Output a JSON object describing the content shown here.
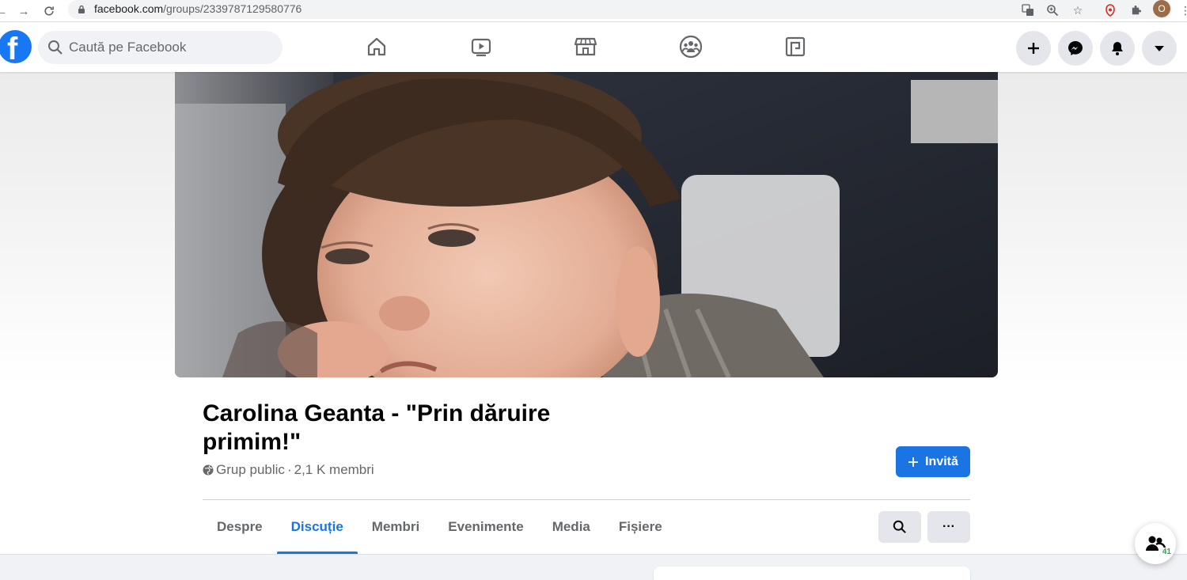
{
  "browser": {
    "url_host": "facebook.com",
    "url_path": "/groups/2339787129580776",
    "profile_initial": "O"
  },
  "fb": {
    "logo": "f",
    "search_placeholder": "Caută pe Facebook",
    "nav_icons": [
      "home-icon",
      "watch-icon",
      "marketplace-icon",
      "groups-icon",
      "gaming-icon"
    ],
    "right_buttons": [
      "create-icon",
      "messenger-icon",
      "notifications-icon",
      "account-menu-icon"
    ]
  },
  "group": {
    "title": "Carolina Geanta - \"Prin dăruire primim!\"",
    "privacy": "Grup public",
    "members": "2,1 K membri",
    "separator": " · ",
    "invite_label": "Invită"
  },
  "tabs": [
    {
      "label": "Despre",
      "active": false
    },
    {
      "label": "Discuție",
      "active": true
    },
    {
      "label": "Membri",
      "active": false
    },
    {
      "label": "Evenimente",
      "active": false
    },
    {
      "label": "Media",
      "active": false
    },
    {
      "label": "Fișiere",
      "active": false
    }
  ],
  "tab_actions": {
    "search": "search-icon",
    "more": "···"
  },
  "chat": {
    "online_count": "41"
  },
  "colors": {
    "brand": "#1877f2",
    "accent": "#1b74e4",
    "active_green": "#31a24c"
  }
}
